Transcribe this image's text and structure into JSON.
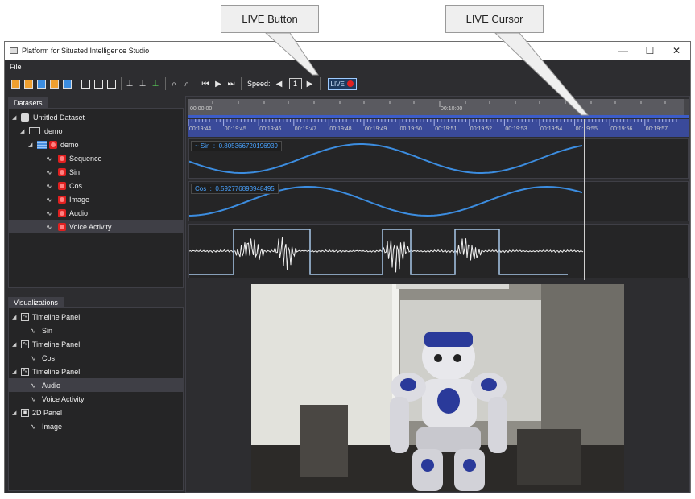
{
  "callouts": {
    "live_button": "LIVE Button",
    "live_cursor": "LIVE Cursor"
  },
  "window": {
    "title": "Platform for Situated Intelligence Studio",
    "minimize": "—",
    "maximize": "☐",
    "close": "✕"
  },
  "menu": {
    "file": "File"
  },
  "toolbar": {
    "speed_label": "Speed:",
    "speed_value": "1",
    "live_label": "LIVE"
  },
  "datasets": {
    "tab_label": "Datasets",
    "nodes": [
      {
        "label": "Untitled Dataset",
        "type": "dataset"
      },
      {
        "label": "demo",
        "type": "partition"
      },
      {
        "label": "demo",
        "type": "session"
      },
      {
        "label": "Sequence",
        "type": "stream"
      },
      {
        "label": "Sin",
        "type": "stream"
      },
      {
        "label": "Cos",
        "type": "stream"
      },
      {
        "label": "Image",
        "type": "stream"
      },
      {
        "label": "Audio",
        "type": "stream"
      },
      {
        "label": "Voice Activity",
        "type": "stream",
        "selected": true
      }
    ]
  },
  "visualizations": {
    "tab_label": "Visualizations",
    "nodes": [
      {
        "label": "Timeline Panel",
        "type": "panel"
      },
      {
        "label": "Sin",
        "type": "visualizer"
      },
      {
        "label": "Timeline Panel",
        "type": "panel"
      },
      {
        "label": "Cos",
        "type": "visualizer"
      },
      {
        "label": "Timeline Panel",
        "type": "panel"
      },
      {
        "label": "Audio",
        "type": "visualizer",
        "selected": true
      },
      {
        "label": "Voice Activity",
        "type": "visualizer"
      },
      {
        "label": "2D Panel",
        "type": "panel2d"
      },
      {
        "label": "Image",
        "type": "visualizer"
      }
    ]
  },
  "navigator": {
    "start_label": "00:00:00",
    "mid_label": "00:10:00"
  },
  "timeline": {
    "ticks": [
      "00:19:44",
      "00:19:45",
      "00:19:46",
      "00:19:47",
      "00:19:48",
      "00:19:49",
      "00:19:50",
      "00:19:51",
      "00:19:52",
      "00:19:53",
      "00:19:54",
      "00:19:55",
      "00:19:56",
      "00:19:57"
    ]
  },
  "panels": {
    "sin": {
      "legend": "~ Sin  :  0.805366720196939"
    },
    "cos": {
      "legend": "Cos  :  0.592776893948495"
    }
  },
  "colors": {
    "accent": "#3c8de0",
    "live_red": "#e02020",
    "background": "#2d2d30"
  }
}
